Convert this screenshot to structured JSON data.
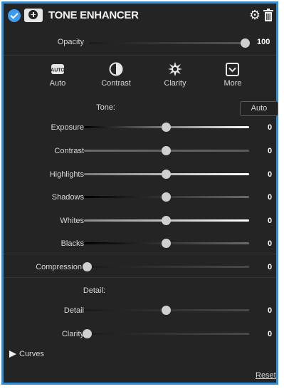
{
  "header": {
    "title": "TONE ENHANCER",
    "enabled": true
  },
  "opacity": {
    "label": "Opacity",
    "value": "100"
  },
  "tools": [
    {
      "label": "Auto",
      "icon": "auto-icon"
    },
    {
      "label": "Contrast",
      "icon": "contrast-icon"
    },
    {
      "label": "Clarity",
      "icon": "clarity-icon"
    },
    {
      "label": "More",
      "icon": "more-chevron-icon"
    }
  ],
  "tone": {
    "heading": "Tone:",
    "auto_button": "Auto",
    "sliders": [
      {
        "label": "Exposure",
        "value": "0"
      },
      {
        "label": "Contrast",
        "value": "0"
      },
      {
        "label": "Highlights",
        "value": "0"
      },
      {
        "label": "Shadows",
        "value": "0"
      },
      {
        "label": "Whites",
        "value": "0"
      },
      {
        "label": "Blacks",
        "value": "0"
      }
    ]
  },
  "compression": {
    "label": "Compression",
    "value": "0"
  },
  "detail": {
    "heading": "Detail:",
    "sliders": [
      {
        "label": "Detail",
        "value": "0"
      },
      {
        "label": "Clarity",
        "value": "0"
      }
    ]
  },
  "curves": {
    "label": "Curves",
    "expanded": false
  },
  "reset": "Reset",
  "colors": {
    "accent": "#2f8ed9",
    "panel": "#242424",
    "text": "#d8d8d8"
  }
}
